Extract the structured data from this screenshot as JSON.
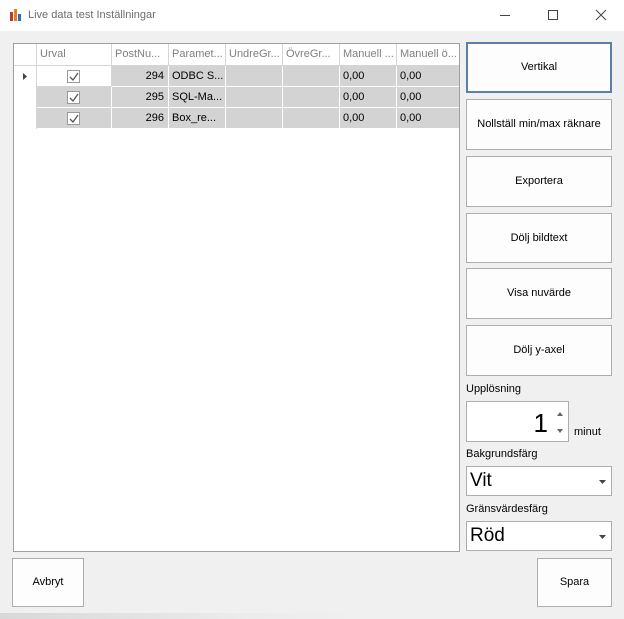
{
  "window": {
    "title": "Live data test Inställningar"
  },
  "grid": {
    "columns": [
      "Urval",
      "PostNu...",
      "Paramet...",
      "UndreGr...",
      "ÖvreGr...",
      "Manuell ...",
      "Manuell ö..."
    ],
    "rows": [
      {
        "urval": true,
        "postnr": "294",
        "parameter": "ODBC S...",
        "undre": "",
        "ovre": "",
        "manuell_u": "0,00",
        "manuell_o": "0,00",
        "current": true
      },
      {
        "urval": true,
        "postnr": "295",
        "parameter": "SQL-Ma...",
        "undre": "",
        "ovre": "",
        "manuell_u": "0,00",
        "manuell_o": "0,00",
        "current": false
      },
      {
        "urval": true,
        "postnr": "296",
        "parameter": "Box_re...",
        "undre": "",
        "ovre": "",
        "manuell_u": "0,00",
        "manuell_o": "0,00",
        "current": false
      }
    ]
  },
  "buttons": {
    "vertikal": "Vertikal",
    "nollstall": "Nollställ min/max räknare",
    "exportera": "Exportera",
    "dolj_bildtext": "Dölj bildtext",
    "visa_nuvarde": "Visa nuvärde",
    "dolj_yaxel": "Dölj y-axel",
    "avbryt": "Avbryt",
    "spara": "Spara"
  },
  "upplosning": {
    "label": "Upplösning",
    "value": "1",
    "unit": "minut"
  },
  "bakgrund": {
    "label": "Bakgrundsfärg",
    "value": "Vit"
  },
  "gransvarde": {
    "label": "Gränsvärdesfärg",
    "value": "Röd"
  },
  "colors": {
    "selected_row": "#d3d3d3",
    "active_border": "#5b7fa8"
  }
}
